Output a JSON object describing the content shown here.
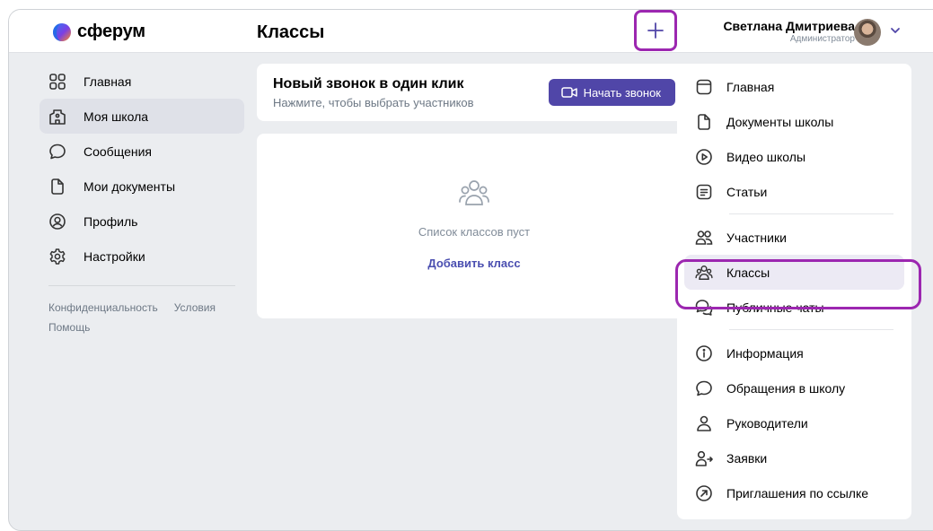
{
  "header": {
    "logo_text": "сферум",
    "page_title": "Классы",
    "user_name": "Светлана Дмитриева",
    "user_role": "Администратор"
  },
  "left_nav": {
    "items": [
      {
        "label": "Главная",
        "icon": "grid-icon"
      },
      {
        "label": "Моя школа",
        "icon": "school-icon",
        "active": true
      },
      {
        "label": "Сообщения",
        "icon": "chat-icon"
      },
      {
        "label": "Мои документы",
        "icon": "document-icon"
      },
      {
        "label": "Профиль",
        "icon": "profile-icon"
      },
      {
        "label": "Настройки",
        "icon": "gear-icon"
      }
    ],
    "footer": {
      "privacy": "Конфиденциальность",
      "terms": "Условия",
      "help": "Помощь"
    }
  },
  "call_card": {
    "title": "Новый звонок в один клик",
    "subtitle": "Нажмите, чтобы выбрать участников",
    "button_label": "Начать звонок"
  },
  "classes_card": {
    "empty_text": "Список классов пуст",
    "add_label": "Добавить класс"
  },
  "right_nav": {
    "items": [
      {
        "label": "Главная",
        "icon": "home-icon"
      },
      {
        "label": "Документы школы",
        "icon": "document-icon"
      },
      {
        "label": "Видео школы",
        "icon": "video-icon"
      },
      {
        "label": "Статьи",
        "icon": "article-icon"
      },
      {
        "label": "Участники",
        "icon": "users-icon"
      },
      {
        "label": "Классы",
        "icon": "group-icon",
        "active": true
      },
      {
        "label": "Публичные чаты",
        "icon": "chats-icon"
      },
      {
        "label": "Информация",
        "icon": "info-icon"
      },
      {
        "label": "Обращения в школу",
        "icon": "chat-icon"
      },
      {
        "label": "Руководители",
        "icon": "user-icon"
      },
      {
        "label": "Заявки",
        "icon": "user-arrow-icon"
      },
      {
        "label": "Приглашения по ссылке",
        "icon": "link-arrow-icon"
      }
    ]
  },
  "colors": {
    "accent": "#5046a8",
    "highlight": "#9c27b0",
    "background": "#ebedf0"
  }
}
